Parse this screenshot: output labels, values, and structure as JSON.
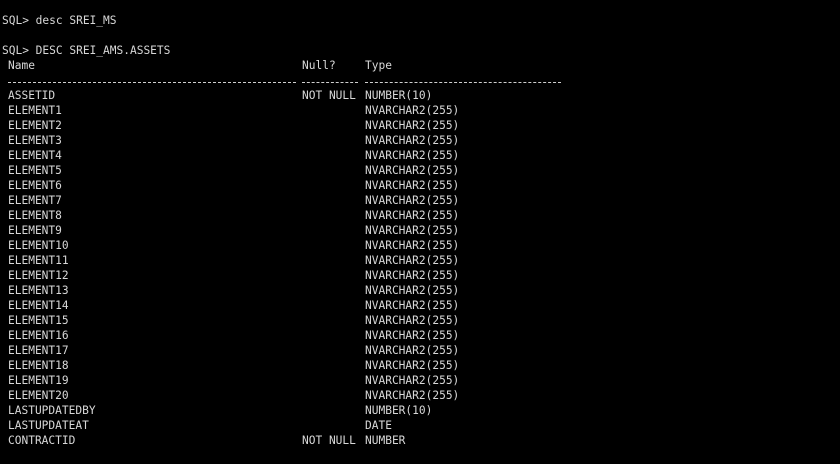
{
  "terminal": {
    "prompt1": "SQL> desc SREI_MS",
    "prompt2": "SQL> DESC SREI_AMS.ASSETS",
    "headers": {
      "name": "Name",
      "null": "Null?",
      "type": "Type"
    },
    "rows": [
      {
        "name": "ASSETID",
        "null": "NOT NULL",
        "type": "NUMBER(10)"
      },
      {
        "name": "ELEMENT1",
        "null": "",
        "type": "NVARCHAR2(255)"
      },
      {
        "name": "ELEMENT2",
        "null": "",
        "type": "NVARCHAR2(255)"
      },
      {
        "name": "ELEMENT3",
        "null": "",
        "type": "NVARCHAR2(255)"
      },
      {
        "name": "ELEMENT4",
        "null": "",
        "type": "NVARCHAR2(255)"
      },
      {
        "name": "ELEMENT5",
        "null": "",
        "type": "NVARCHAR2(255)"
      },
      {
        "name": "ELEMENT6",
        "null": "",
        "type": "NVARCHAR2(255)"
      },
      {
        "name": "ELEMENT7",
        "null": "",
        "type": "NVARCHAR2(255)"
      },
      {
        "name": "ELEMENT8",
        "null": "",
        "type": "NVARCHAR2(255)"
      },
      {
        "name": "ELEMENT9",
        "null": "",
        "type": "NVARCHAR2(255)"
      },
      {
        "name": "ELEMENT10",
        "null": "",
        "type": "NVARCHAR2(255)"
      },
      {
        "name": "ELEMENT11",
        "null": "",
        "type": "NVARCHAR2(255)"
      },
      {
        "name": "ELEMENT12",
        "null": "",
        "type": "NVARCHAR2(255)"
      },
      {
        "name": "ELEMENT13",
        "null": "",
        "type": "NVARCHAR2(255)"
      },
      {
        "name": "ELEMENT14",
        "null": "",
        "type": "NVARCHAR2(255)"
      },
      {
        "name": "ELEMENT15",
        "null": "",
        "type": "NVARCHAR2(255)"
      },
      {
        "name": "ELEMENT16",
        "null": "",
        "type": "NVARCHAR2(255)"
      },
      {
        "name": "ELEMENT17",
        "null": "",
        "type": "NVARCHAR2(255)"
      },
      {
        "name": "ELEMENT18",
        "null": "",
        "type": "NVARCHAR2(255)"
      },
      {
        "name": "ELEMENT19",
        "null": "",
        "type": "NVARCHAR2(255)"
      },
      {
        "name": "ELEMENT20",
        "null": "",
        "type": "NVARCHAR2(255)"
      },
      {
        "name": "LASTUPDATEDBY",
        "null": "",
        "type": "NUMBER(10)"
      },
      {
        "name": "LASTUPDATEAT",
        "null": "",
        "type": "DATE"
      },
      {
        "name": "CONTRACTID",
        "null": "NOT NULL",
        "type": "NUMBER"
      }
    ]
  },
  "colors": {
    "background": "#000000",
    "text": "#d8d8d8"
  }
}
